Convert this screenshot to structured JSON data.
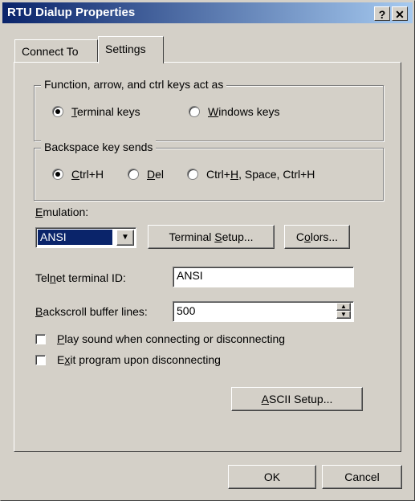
{
  "window": {
    "title": "RTU Dialup Properties",
    "help_label": "?",
    "close_label": "✕"
  },
  "tabs": [
    {
      "label": "Connect To"
    },
    {
      "label": "Settings"
    }
  ],
  "keys_group": {
    "legend": "Function, arrow, and ctrl keys act as",
    "options": [
      {
        "u": "T",
        "rest": "erminal keys",
        "selected": true
      },
      {
        "u": "W",
        "rest": "indows keys",
        "selected": false
      }
    ]
  },
  "backspace_group": {
    "legend": "Backspace key sends",
    "options": [
      {
        "pre": "",
        "u": "C",
        "rest": "trl+H",
        "selected": true
      },
      {
        "pre": "",
        "u": "D",
        "rest": "el",
        "selected": false
      },
      {
        "pre": "Ctrl+",
        "u": "H",
        "rest": ", Space, Ctrl+H",
        "selected": false
      }
    ]
  },
  "emulation": {
    "label_u": "E",
    "label_rest": "mulation:",
    "value": "ANSI",
    "terminal_setup": {
      "pre": "Terminal ",
      "u": "S",
      "rest": "etup..."
    },
    "colors": {
      "pre": "C",
      "u": "o",
      "rest": "lors..."
    }
  },
  "telnet": {
    "label_pre": "Tel",
    "label_u": "n",
    "label_rest": "et terminal ID:",
    "value": "ANSI"
  },
  "backscroll": {
    "label_u": "B",
    "label_rest": "ackscroll buffer lines:",
    "value": "500"
  },
  "checkboxes": [
    {
      "u": "P",
      "rest": "lay sound when connecting or disconnecting",
      "checked": false
    },
    {
      "pre": "E",
      "u": "x",
      "rest": "it program upon disconnecting",
      "checked": false
    }
  ],
  "ascii_setup": {
    "u": "A",
    "rest": "SCII Setup..."
  },
  "footer": {
    "ok": "OK",
    "cancel": "Cancel"
  }
}
